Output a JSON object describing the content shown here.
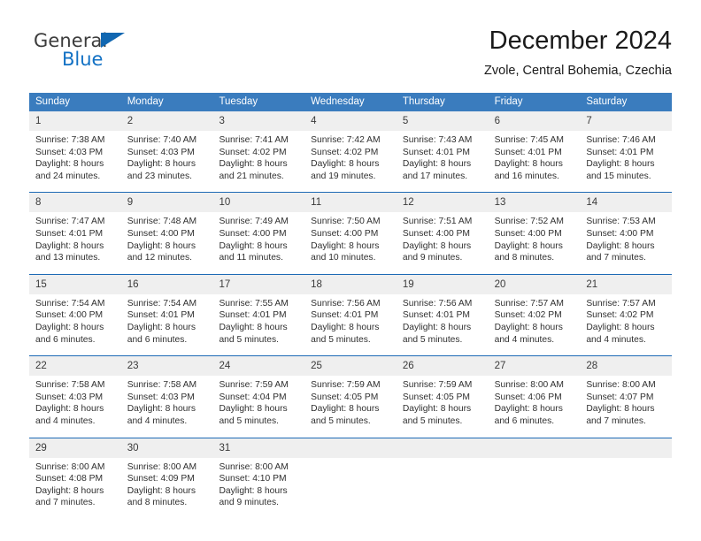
{
  "logo": {
    "primary_text": "General",
    "secondary_text": "Blue",
    "triangle_icon": "blue-triangle-icon",
    "accent_color": "#1271c4"
  },
  "header": {
    "title": "December 2024",
    "subtitle": "Zvole, Central Bohemia, Czechia"
  },
  "calendar": {
    "header_bg": "#3a7cbe",
    "row_border_color": "#1d6ab5",
    "day_band_bg": "#efefef",
    "weekdays": [
      "Sunday",
      "Monday",
      "Tuesday",
      "Wednesday",
      "Thursday",
      "Friday",
      "Saturday"
    ],
    "weeks": [
      [
        {
          "day": "1",
          "sunrise": "Sunrise: 7:38 AM",
          "sunset": "Sunset: 4:03 PM",
          "daylight1": "Daylight: 8 hours",
          "daylight2": "and 24 minutes."
        },
        {
          "day": "2",
          "sunrise": "Sunrise: 7:40 AM",
          "sunset": "Sunset: 4:03 PM",
          "daylight1": "Daylight: 8 hours",
          "daylight2": "and 23 minutes."
        },
        {
          "day": "3",
          "sunrise": "Sunrise: 7:41 AM",
          "sunset": "Sunset: 4:02 PM",
          "daylight1": "Daylight: 8 hours",
          "daylight2": "and 21 minutes."
        },
        {
          "day": "4",
          "sunrise": "Sunrise: 7:42 AM",
          "sunset": "Sunset: 4:02 PM",
          "daylight1": "Daylight: 8 hours",
          "daylight2": "and 19 minutes."
        },
        {
          "day": "5",
          "sunrise": "Sunrise: 7:43 AM",
          "sunset": "Sunset: 4:01 PM",
          "daylight1": "Daylight: 8 hours",
          "daylight2": "and 17 minutes."
        },
        {
          "day": "6",
          "sunrise": "Sunrise: 7:45 AM",
          "sunset": "Sunset: 4:01 PM",
          "daylight1": "Daylight: 8 hours",
          "daylight2": "and 16 minutes."
        },
        {
          "day": "7",
          "sunrise": "Sunrise: 7:46 AM",
          "sunset": "Sunset: 4:01 PM",
          "daylight1": "Daylight: 8 hours",
          "daylight2": "and 15 minutes."
        }
      ],
      [
        {
          "day": "8",
          "sunrise": "Sunrise: 7:47 AM",
          "sunset": "Sunset: 4:01 PM",
          "daylight1": "Daylight: 8 hours",
          "daylight2": "and 13 minutes."
        },
        {
          "day": "9",
          "sunrise": "Sunrise: 7:48 AM",
          "sunset": "Sunset: 4:00 PM",
          "daylight1": "Daylight: 8 hours",
          "daylight2": "and 12 minutes."
        },
        {
          "day": "10",
          "sunrise": "Sunrise: 7:49 AM",
          "sunset": "Sunset: 4:00 PM",
          "daylight1": "Daylight: 8 hours",
          "daylight2": "and 11 minutes."
        },
        {
          "day": "11",
          "sunrise": "Sunrise: 7:50 AM",
          "sunset": "Sunset: 4:00 PM",
          "daylight1": "Daylight: 8 hours",
          "daylight2": "and 10 minutes."
        },
        {
          "day": "12",
          "sunrise": "Sunrise: 7:51 AM",
          "sunset": "Sunset: 4:00 PM",
          "daylight1": "Daylight: 8 hours",
          "daylight2": "and 9 minutes."
        },
        {
          "day": "13",
          "sunrise": "Sunrise: 7:52 AM",
          "sunset": "Sunset: 4:00 PM",
          "daylight1": "Daylight: 8 hours",
          "daylight2": "and 8 minutes."
        },
        {
          "day": "14",
          "sunrise": "Sunrise: 7:53 AM",
          "sunset": "Sunset: 4:00 PM",
          "daylight1": "Daylight: 8 hours",
          "daylight2": "and 7 minutes."
        }
      ],
      [
        {
          "day": "15",
          "sunrise": "Sunrise: 7:54 AM",
          "sunset": "Sunset: 4:00 PM",
          "daylight1": "Daylight: 8 hours",
          "daylight2": "and 6 minutes."
        },
        {
          "day": "16",
          "sunrise": "Sunrise: 7:54 AM",
          "sunset": "Sunset: 4:01 PM",
          "daylight1": "Daylight: 8 hours",
          "daylight2": "and 6 minutes."
        },
        {
          "day": "17",
          "sunrise": "Sunrise: 7:55 AM",
          "sunset": "Sunset: 4:01 PM",
          "daylight1": "Daylight: 8 hours",
          "daylight2": "and 5 minutes."
        },
        {
          "day": "18",
          "sunrise": "Sunrise: 7:56 AM",
          "sunset": "Sunset: 4:01 PM",
          "daylight1": "Daylight: 8 hours",
          "daylight2": "and 5 minutes."
        },
        {
          "day": "19",
          "sunrise": "Sunrise: 7:56 AM",
          "sunset": "Sunset: 4:01 PM",
          "daylight1": "Daylight: 8 hours",
          "daylight2": "and 5 minutes."
        },
        {
          "day": "20",
          "sunrise": "Sunrise: 7:57 AM",
          "sunset": "Sunset: 4:02 PM",
          "daylight1": "Daylight: 8 hours",
          "daylight2": "and 4 minutes."
        },
        {
          "day": "21",
          "sunrise": "Sunrise: 7:57 AM",
          "sunset": "Sunset: 4:02 PM",
          "daylight1": "Daylight: 8 hours",
          "daylight2": "and 4 minutes."
        }
      ],
      [
        {
          "day": "22",
          "sunrise": "Sunrise: 7:58 AM",
          "sunset": "Sunset: 4:03 PM",
          "daylight1": "Daylight: 8 hours",
          "daylight2": "and 4 minutes."
        },
        {
          "day": "23",
          "sunrise": "Sunrise: 7:58 AM",
          "sunset": "Sunset: 4:03 PM",
          "daylight1": "Daylight: 8 hours",
          "daylight2": "and 4 minutes."
        },
        {
          "day": "24",
          "sunrise": "Sunrise: 7:59 AM",
          "sunset": "Sunset: 4:04 PM",
          "daylight1": "Daylight: 8 hours",
          "daylight2": "and 5 minutes."
        },
        {
          "day": "25",
          "sunrise": "Sunrise: 7:59 AM",
          "sunset": "Sunset: 4:05 PM",
          "daylight1": "Daylight: 8 hours",
          "daylight2": "and 5 minutes."
        },
        {
          "day": "26",
          "sunrise": "Sunrise: 7:59 AM",
          "sunset": "Sunset: 4:05 PM",
          "daylight1": "Daylight: 8 hours",
          "daylight2": "and 5 minutes."
        },
        {
          "day": "27",
          "sunrise": "Sunrise: 8:00 AM",
          "sunset": "Sunset: 4:06 PM",
          "daylight1": "Daylight: 8 hours",
          "daylight2": "and 6 minutes."
        },
        {
          "day": "28",
          "sunrise": "Sunrise: 8:00 AM",
          "sunset": "Sunset: 4:07 PM",
          "daylight1": "Daylight: 8 hours",
          "daylight2": "and 7 minutes."
        }
      ],
      [
        {
          "day": "29",
          "sunrise": "Sunrise: 8:00 AM",
          "sunset": "Sunset: 4:08 PM",
          "daylight1": "Daylight: 8 hours",
          "daylight2": "and 7 minutes."
        },
        {
          "day": "30",
          "sunrise": "Sunrise: 8:00 AM",
          "sunset": "Sunset: 4:09 PM",
          "daylight1": "Daylight: 8 hours",
          "daylight2": "and 8 minutes."
        },
        {
          "day": "31",
          "sunrise": "Sunrise: 8:00 AM",
          "sunset": "Sunset: 4:10 PM",
          "daylight1": "Daylight: 8 hours",
          "daylight2": "and 9 minutes."
        },
        {
          "day": "",
          "sunrise": "",
          "sunset": "",
          "daylight1": "",
          "daylight2": ""
        },
        {
          "day": "",
          "sunrise": "",
          "sunset": "",
          "daylight1": "",
          "daylight2": ""
        },
        {
          "day": "",
          "sunrise": "",
          "sunset": "",
          "daylight1": "",
          "daylight2": ""
        },
        {
          "day": "",
          "sunrise": "",
          "sunset": "",
          "daylight1": "",
          "daylight2": ""
        }
      ]
    ]
  }
}
